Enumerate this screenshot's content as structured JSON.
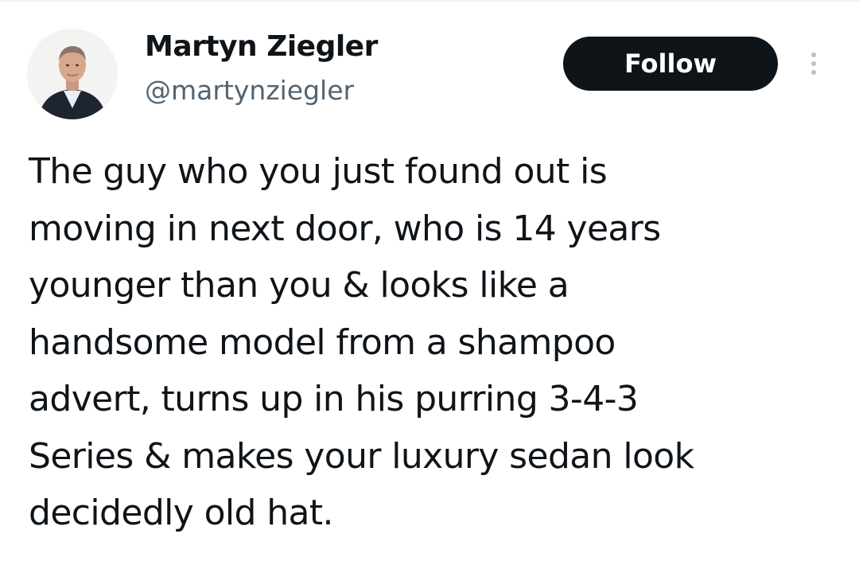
{
  "author": {
    "display_name": "Martyn Ziegler",
    "handle": "@martynziegler",
    "avatar_icon": "profile-photo"
  },
  "actions": {
    "follow_label": "Follow",
    "more_icon": "more-options-icon"
  },
  "tweet": {
    "lines": [
      "The guy who you just found out is",
      "moving in next door, who is 14 years",
      "younger than you & looks like a",
      "handsome model from a shampoo",
      "advert, turns up in his purring 3-4-3",
      "Series & makes your luxury sedan look",
      "decidedly old hat."
    ]
  },
  "colors": {
    "text": "#0f1419",
    "secondary_text": "#536471",
    "button_bg": "#0f1419",
    "button_text": "#ffffff"
  }
}
